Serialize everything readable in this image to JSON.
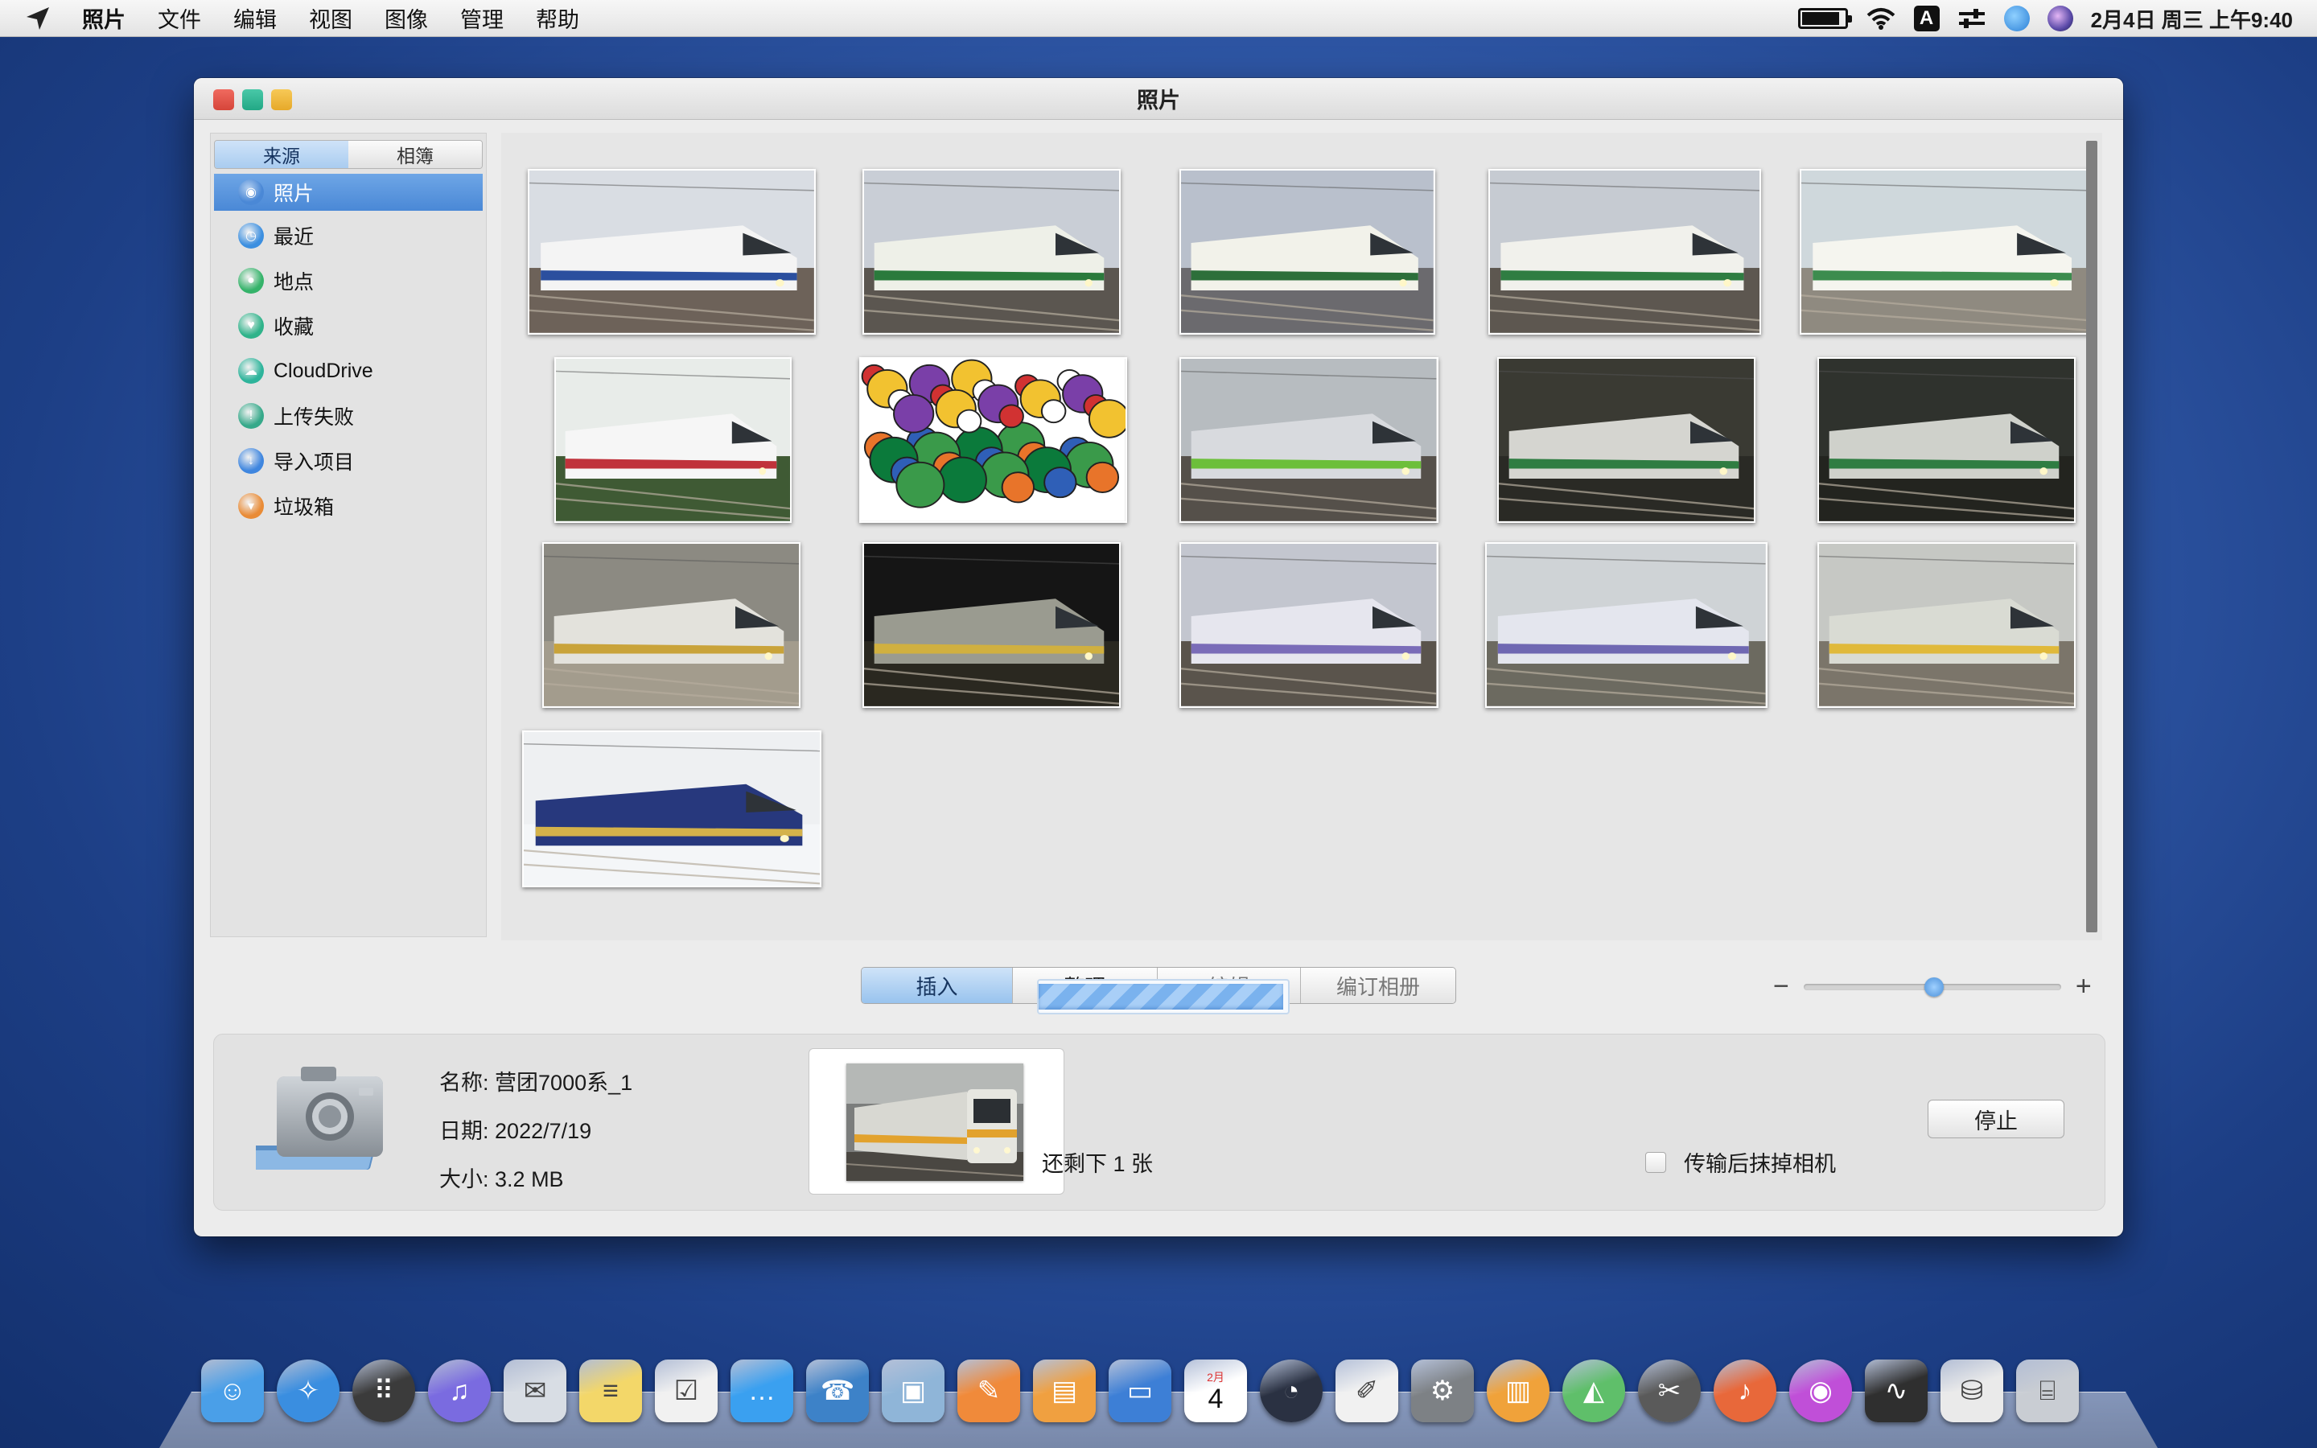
{
  "menubar": {
    "app_name": "照片",
    "items": [
      "文件",
      "编辑",
      "视图",
      "图像",
      "管理",
      "帮助"
    ],
    "input_indicator": "A",
    "clock": "2月4日 周三 上午9:40",
    "battery_level": 0.9
  },
  "window": {
    "title": "照片"
  },
  "sidebar": {
    "segments": [
      "来源",
      "相簿"
    ],
    "active_segment": "来源",
    "items": [
      {
        "label": "照片",
        "icon": "camera-icon",
        "color": "#4a88d6",
        "selected": true
      },
      {
        "label": "最近",
        "icon": "clock-icon",
        "color": "#3c8fe0",
        "selected": false
      },
      {
        "label": "地点",
        "icon": "map-pin-icon",
        "color": "#35b36a",
        "selected": false
      },
      {
        "label": "收藏",
        "icon": "heart-icon",
        "color": "#2fb38a",
        "selected": false
      },
      {
        "label": "CloudDrive",
        "icon": "cloud-icon",
        "color": "#2eb49b",
        "selected": false
      },
      {
        "label": "上传失败",
        "icon": "warning-icon",
        "color": "#36a98a",
        "selected": false
      },
      {
        "label": "导入项目",
        "icon": "download-icon",
        "color": "#3f86df",
        "selected": false
      },
      {
        "label": "垃圾箱",
        "icon": "trash-icon",
        "color": "#e98b36",
        "selected": false
      }
    ]
  },
  "photos": [
    {
      "name": "shinkansen-0-series",
      "sky": "#d9dde3",
      "ground": "#6d6259",
      "body": "#f4f4f4",
      "stripe": "#2b4f9e"
    },
    {
      "name": "shinkansen-200-green",
      "sky": "#c9ced6",
      "ground": "#5b5650",
      "body": "#eef0e8",
      "stripe": "#2a7a3c"
    },
    {
      "name": "shinkansen-200-viaduct",
      "sky": "#b9c0cc",
      "ground": "#6b6a6e",
      "body": "#f2f2ea",
      "stripe": "#2d6f3a"
    },
    {
      "name": "shinkansen-depot",
      "sky": "#c6cbd2",
      "ground": "#5d5750",
      "body": "#f1f1ec",
      "stripe": "#2f7d42"
    },
    {
      "name": "shinkansen-station",
      "sky": "#cfd8dc",
      "ground": "#8f8a80",
      "body": "#f5f5ef",
      "stripe": "#3c8c4e"
    },
    {
      "name": "red-stripe-train",
      "sky": "#e8ece9",
      "ground": "#3f5a34",
      "body": "#f6f6f6",
      "stripe": "#c0323b"
    },
    {
      "name": "countryballs",
      "sky": "#ffffff",
      "ground": "#ffffff",
      "body": "#d13232",
      "stripe": "#2f5fb7"
    },
    {
      "name": "green-commuter",
      "sky": "#b7bcc0",
      "ground": "#55504a",
      "body": "#d8dade",
      "stripe": "#6cbf3a"
    },
    {
      "name": "subway-tunnel-1",
      "sky": "#3a3a33",
      "ground": "#2a2a25",
      "body": "#d5d5d0",
      "stripe": "#2f7d42"
    },
    {
      "name": "subway-tunnel-2",
      "sky": "#2f322d",
      "ground": "#23241f",
      "body": "#cfd1cb",
      "stripe": "#2f7d42"
    },
    {
      "name": "subway-platform",
      "sky": "#8c8a82",
      "ground": "#a39c8d",
      "body": "#e3e2dc",
      "stripe": "#c9a33a"
    },
    {
      "name": "dark-tunnel",
      "sky": "#151515",
      "ground": "#2a2820",
      "body": "#9a9b90",
      "stripe": "#d0b040"
    },
    {
      "name": "e351-purple",
      "sky": "#c3c6cf",
      "ground": "#5a544c",
      "body": "#e6e6ee",
      "stripe": "#7a6cb8"
    },
    {
      "name": "e351-curve",
      "sky": "#cfd3d6",
      "ground": "#6c6a60",
      "body": "#e4e6ee",
      "stripe": "#6f68b2"
    },
    {
      "name": "yellow-stripe-commuter",
      "sky": "#c6c8c4",
      "ground": "#7b756a",
      "body": "#d9dbd3",
      "stripe": "#e0b93a"
    },
    {
      "name": "blue-sleeper-snow",
      "sky": "#eef0f2",
      "ground": "#f4f6f8",
      "body": "#27387d",
      "stripe": "#d4b24a"
    }
  ],
  "modes": {
    "items": [
      "插入",
      "整理",
      "编辑",
      "编订相册"
    ],
    "active": "插入"
  },
  "zoom": {
    "minus": "−",
    "plus": "+",
    "level": 0.5
  },
  "import": {
    "name_label": "名称:",
    "name_value": "营团7000系_1",
    "date_label": "日期:",
    "date_value": "2022/7/19",
    "size_label": "大小:",
    "size_value": "3.2 MB",
    "progress": 0.98,
    "remaining": "还剩下 1 张",
    "erase_label": "传输后抹掉相机",
    "erase_checked": false,
    "stop_label": "停止"
  },
  "dock": {
    "calendar_month": "2月",
    "calendar_day": "4",
    "items": [
      {
        "name": "finder-icon",
        "color": "#4a9fe8"
      },
      {
        "name": "safari-icon",
        "color": "#3a8ee0"
      },
      {
        "name": "launchpad-icon",
        "color": "#3b3b3b"
      },
      {
        "name": "itunes-icon",
        "color": "#7a6be0"
      },
      {
        "name": "mail-icon",
        "color": "#d8dde4"
      },
      {
        "name": "notes-icon",
        "color": "#f3d769"
      },
      {
        "name": "reminders-icon",
        "color": "#f1f1f1"
      },
      {
        "name": "messages-icon",
        "color": "#3aa0f0"
      },
      {
        "name": "contacts-icon",
        "color": "#3d82c8"
      },
      {
        "name": "preview-icon",
        "color": "#8fb5d8"
      },
      {
        "name": "pages-icon",
        "color": "#f08a3a"
      },
      {
        "name": "numbers-icon",
        "color": "#f0a040"
      },
      {
        "name": "keynote-icon",
        "color": "#3d7fd6"
      },
      {
        "name": "calendar-icon",
        "color": "#ffffff"
      },
      {
        "name": "time-machine-icon",
        "color": "#2a3142"
      },
      {
        "name": "textedit-icon",
        "color": "#f1f1f1"
      },
      {
        "name": "system-preferences-icon",
        "color": "#7d8185"
      },
      {
        "name": "ibooks-icon",
        "color": "#f0a23a"
      },
      {
        "name": "maps-icon",
        "color": "#5fbf6a"
      },
      {
        "name": "photo-booth-icon",
        "color": "#5a5a5a"
      },
      {
        "name": "garageband-icon",
        "color": "#e8683a"
      },
      {
        "name": "podcast-icon",
        "color": "#c04fd8"
      },
      {
        "name": "activity-monitor-icon",
        "color": "#2f2f2f"
      },
      {
        "name": "dmg-file-icon",
        "color": "#eaeaea"
      },
      {
        "name": "trash-icon",
        "color": "#c9cdd3"
      }
    ]
  }
}
